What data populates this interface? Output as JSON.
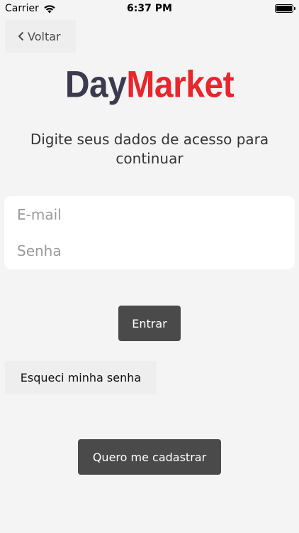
{
  "status_bar": {
    "carrier": "Carrier",
    "time": "6:37 PM"
  },
  "nav": {
    "back_label": "Voltar"
  },
  "logo": {
    "part1": "Day",
    "part2": "Market",
    "color_part1": "#3c3a4e",
    "color_part2": "#e8262c"
  },
  "subtitle": "Digite seus dados de acesso para continuar",
  "form": {
    "email_placeholder": "E-mail",
    "email_value": "",
    "password_placeholder": "Senha",
    "password_value": ""
  },
  "buttons": {
    "login": "Entrar",
    "forgot_password": "Esqueci minha senha",
    "signup": "Quero me cadastrar"
  },
  "icons": {
    "wifi": "wifi-icon",
    "battery": "battery-icon",
    "back": "chevron-left-icon"
  }
}
